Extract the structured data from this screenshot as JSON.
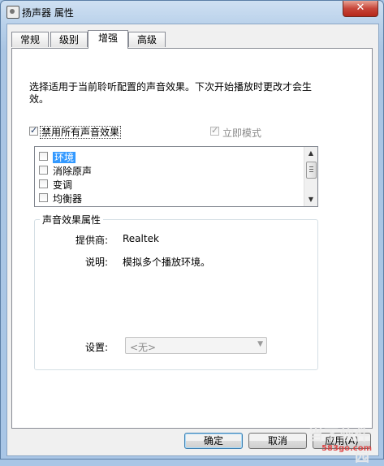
{
  "window": {
    "title": "扬声器 属性",
    "close_glyph": "✕"
  },
  "tabs": [
    {
      "label": "常规",
      "active": false
    },
    {
      "label": "级别",
      "active": false
    },
    {
      "label": "增强",
      "active": true
    },
    {
      "label": "高级",
      "active": false
    }
  ],
  "enhancements": {
    "description": "选择适用于当前聆听配置的声音效果。下次开始播放时更改才会生效。",
    "disable_all_label": "禁用所有声音效果",
    "disable_all_checked": true,
    "immediate_mode_label": "立即模式",
    "immediate_mode_checked": true,
    "immediate_mode_enabled": false,
    "effects": [
      {
        "label": "环境",
        "checked": false,
        "selected": true
      },
      {
        "label": "消除原声",
        "checked": false,
        "selected": false
      },
      {
        "label": "变调",
        "checked": false,
        "selected": false
      },
      {
        "label": "均衡器",
        "checked": false,
        "selected": false
      }
    ],
    "properties": {
      "group_title": "声音效果属性",
      "provider_label": "提供商:",
      "provider_value": "Realtek",
      "desc_label": "说明:",
      "desc_value": "模拟多个播放环境。",
      "settings_label": "设置:",
      "settings_value": "<无>"
    }
  },
  "buttons": {
    "ok": "确定",
    "cancel": "取消",
    "apply": "应用(A)"
  },
  "watermark": {
    "logo": "当下软件园",
    "url": "583go.com"
  },
  "colors": {
    "selection": "#3399ff",
    "close_button": "#c7463a",
    "frame": "#a9c6e6"
  }
}
